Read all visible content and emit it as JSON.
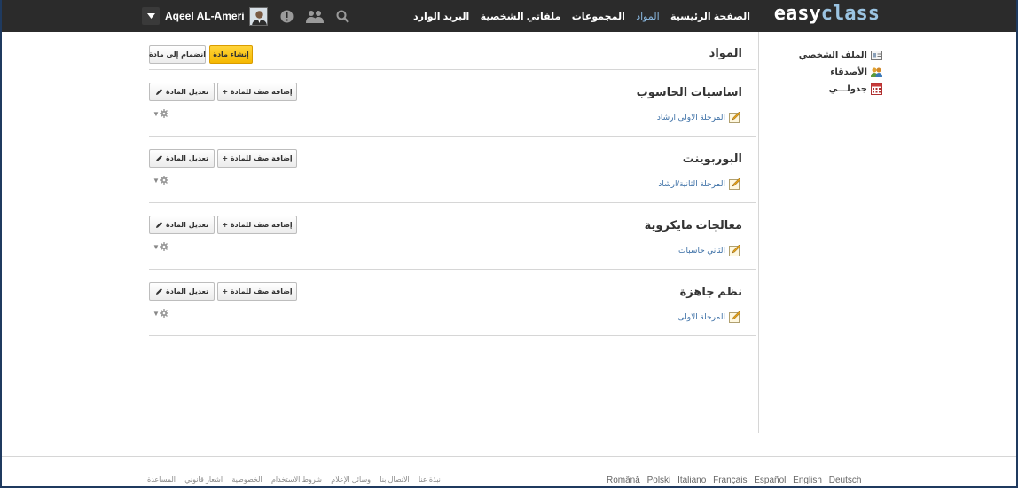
{
  "brand": {
    "part1": "easy",
    "part2": "class"
  },
  "nav": {
    "items": [
      {
        "label": "الصفحة الرئيسية",
        "active": false
      },
      {
        "label": "المواد",
        "active": true
      },
      {
        "label": "المجموعات",
        "active": false
      },
      {
        "label": "ملفاتي الشخصية",
        "active": false
      },
      {
        "label": "البريد الوارد",
        "active": false
      }
    ]
  },
  "user": {
    "name": "Aqeel AL-Ameri"
  },
  "sidebar": {
    "items": [
      {
        "label": "الملف الشخصي",
        "icon": "profile-card-icon"
      },
      {
        "label": "الأصدقاء",
        "icon": "friends-icon"
      },
      {
        "label": "جدولـــي",
        "icon": "calendar-icon"
      }
    ]
  },
  "main": {
    "title": "المواد",
    "create_button": "إنشاء مادة",
    "join_button": "انضمام إلى مادة",
    "add_class_button": "+ إضافة صف للمادة",
    "edit_course_button": "تعديل المادة",
    "courses": [
      {
        "title": "اساسيات الحاسوب",
        "class": "المرحلة الاولى ارشاد"
      },
      {
        "title": "البوربوينت",
        "class": "المرحلة الثانية/ارشاد"
      },
      {
        "title": "معالجات مايكروية",
        "class": "الثاني حاسبات"
      },
      {
        "title": "نظم جاهزة",
        "class": "المرحلة الاولى"
      }
    ]
  },
  "footer": {
    "links": [
      "نبذة عنا",
      "الاتصال بنا",
      "وسائل الإعلام",
      "شروط الاستخدام",
      "الخصوصية",
      "اشعار قانوني",
      "المساعدة"
    ],
    "languages": [
      "Română",
      "Polski",
      "Italiano",
      "Français",
      "Español",
      "English",
      "Deutsch"
    ]
  },
  "colors": {
    "topbar": "#2b2b2b",
    "accent": "#8ab8e0",
    "yellow_button": "#f5b800",
    "link": "#3a6ea5"
  }
}
